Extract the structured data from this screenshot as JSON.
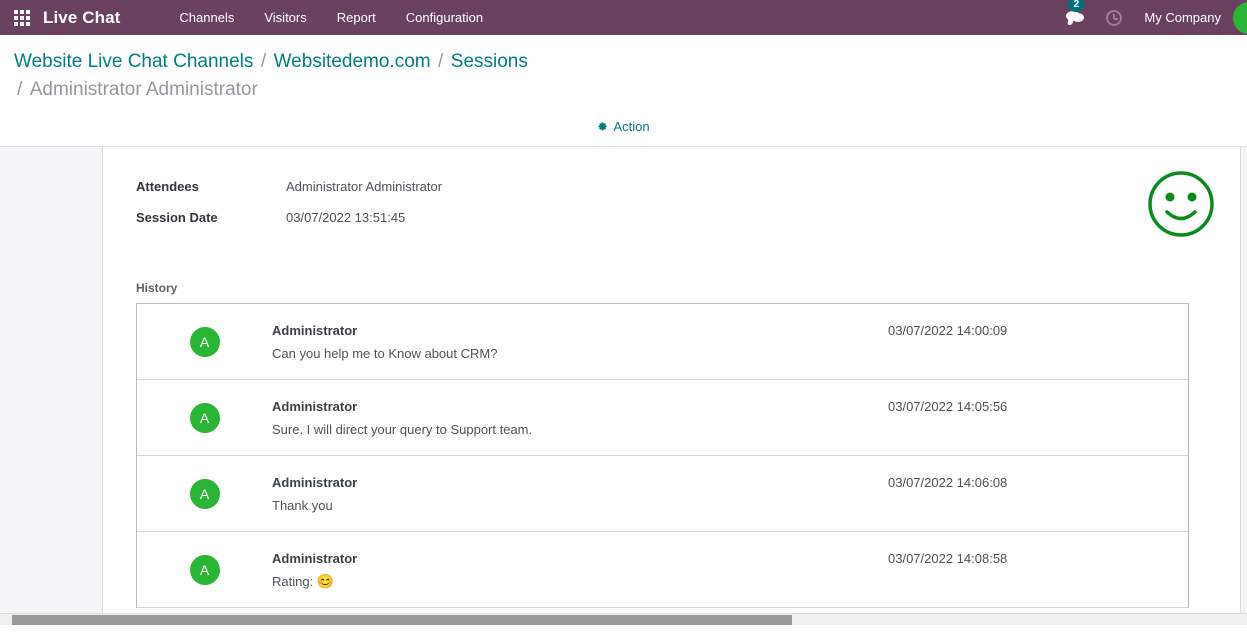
{
  "navbar": {
    "apps_icon": "apps-grid-icon",
    "brand": "Live Chat",
    "menu": [
      {
        "label": "Channels"
      },
      {
        "label": "Visitors"
      },
      {
        "label": "Report"
      },
      {
        "label": "Configuration"
      }
    ],
    "messages_icon": "chat-bubble-icon",
    "messages_count": "2",
    "activities_icon": "clock-icon",
    "company": "My Company",
    "avatar_initial": "A",
    "bg_color": "#6b4160",
    "badge_color": "#00707f"
  },
  "breadcrumb": {
    "items": [
      {
        "label": "Website Live Chat Channels",
        "current": false
      },
      {
        "label": "Websitedemo.com",
        "current": false
      },
      {
        "label": "Sessions",
        "current": false
      },
      {
        "label": "Administrator Administrator",
        "current": true
      }
    ],
    "separator": "/",
    "link_color": "#017e84"
  },
  "action_bar": {
    "gear_icon": "gear-icon",
    "action_label": "Action"
  },
  "form": {
    "fields": [
      {
        "label": "Attendees",
        "value": "Administrator Administrator"
      },
      {
        "label": "Session Date",
        "value": "03/07/2022 13:51:45"
      }
    ],
    "rating_icon": "smiley-face-icon",
    "rating_color": "#0a8b1c"
  },
  "history": {
    "label": "History",
    "messages": [
      {
        "avatar_initial": "A",
        "author": "Administrator",
        "text": "Can you help me to Know about CRM?",
        "emoji": "",
        "date": "03/07/2022 14:00:09"
      },
      {
        "avatar_initial": "A",
        "author": "Administrator",
        "text": "Sure. I will direct your query to Support team.",
        "emoji": "",
        "date": "03/07/2022 14:05:56"
      },
      {
        "avatar_initial": "A",
        "author": "Administrator",
        "text": "Thank you",
        "emoji": "",
        "date": "03/07/2022 14:06:08"
      },
      {
        "avatar_initial": "A",
        "author": "Administrator",
        "text": "Rating: ",
        "emoji": "😊",
        "date": "03/07/2022 14:08:58"
      }
    ],
    "avatar_color": "#2bb534"
  }
}
